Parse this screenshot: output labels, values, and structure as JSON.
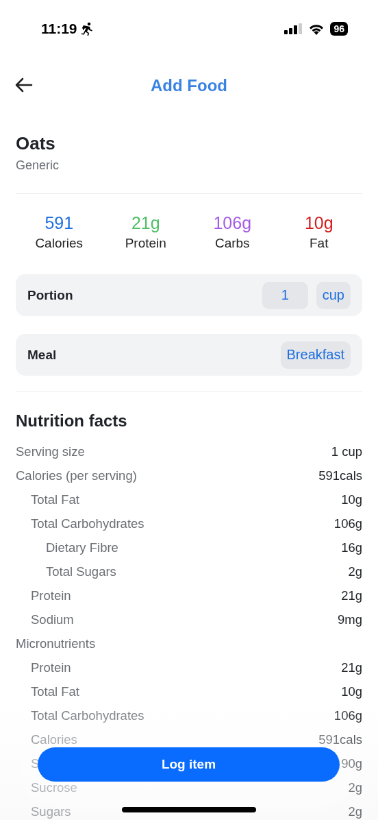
{
  "status_bar": {
    "time": "11:19",
    "battery": "96"
  },
  "header": {
    "title": "Add Food"
  },
  "food": {
    "name": "Oats",
    "brand": "Generic"
  },
  "macros": [
    {
      "value": "591",
      "label": "Calories",
      "color": "#1f6fe0"
    },
    {
      "value": "21g",
      "label": "Protein",
      "color": "#4fbf65"
    },
    {
      "value": "106g",
      "label": "Carbs",
      "color": "#a55be6"
    },
    {
      "value": "10g",
      "label": "Fat",
      "color": "#d41c1c"
    }
  ],
  "settings": [
    {
      "label": "Portion",
      "controls": [
        "1",
        "cup"
      ]
    },
    {
      "label": "Meal",
      "controls": [
        "Breakfast"
      ]
    }
  ],
  "nutrition": {
    "title": "Nutrition facts",
    "rows": [
      {
        "label": "Serving size",
        "value": "1 cup"
      },
      {
        "label": "Calories (per serving)",
        "value": "591cals",
        "children": [
          {
            "label": "Total Fat",
            "value": "10g"
          },
          {
            "label": "Total Carbohydrates",
            "value": "106g",
            "children": [
              {
                "label": "Dietary Fibre",
                "value": "16g"
              },
              {
                "label": "Total Sugars",
                "value": "2g"
              }
            ]
          },
          {
            "label": "Protein",
            "value": "21g"
          },
          {
            "label": "Sodium",
            "value": "9mg"
          }
        ]
      },
      {
        "label": "Micronutrients",
        "children": [
          {
            "label": "Protein",
            "value": "21g"
          },
          {
            "label": "Total Fat",
            "value": "10g"
          },
          {
            "label": "Total Carbohydrates",
            "value": "106g"
          },
          {
            "label": "Calories",
            "value": "591cals"
          },
          {
            "label": "S",
            "value": "90g"
          },
          {
            "label": "Sucrose",
            "value": "2g"
          },
          {
            "label": "Sugars",
            "value": "2g"
          }
        ]
      }
    ]
  },
  "action_button": {
    "label": "Log item"
  }
}
